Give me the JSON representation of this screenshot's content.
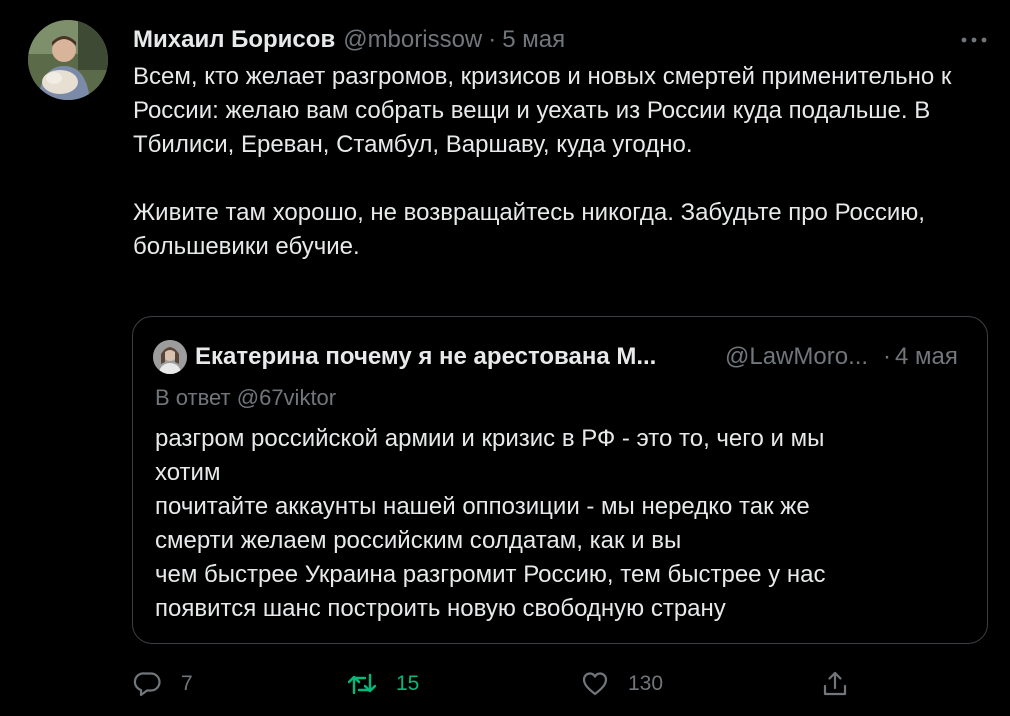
{
  "tweet": {
    "author_name": "Михаил Борисов",
    "handle": "@mborissow",
    "separator": "·",
    "date": "5 мая",
    "text_paragraphs": [
      "Всем, кто желает разгромов, кризисов и новых смертей применительно к России: желаю вам собрать вещи и уехать из России куда подальше. В Тбилиси, Ереван, Стамбул, Варшаву, куда угодно.",
      "Живите там хорошо, не возвращайтесь никогда. Забудьте про Россию, большевики ебучие."
    ]
  },
  "quote": {
    "author_name": "Екатерина почему я не арестована М...",
    "handle": "@LawMoro...",
    "separator": "·",
    "date": "4 мая",
    "reply_to": "В ответ @67viktor",
    "text_lines": [
      "разгром российской армии и кризис в РФ - это то, чего и мы",
      "хотим",
      "почитайте аккаунты нашей оппозиции - мы нередко так же",
      "смерти желаем российским солдатам, как и вы",
      "чем быстрее Украина разгромит Россию, тем быстрее у нас",
      "появится шанс построить новую свободную страну"
    ]
  },
  "actions": {
    "reply_count": "7",
    "retweet_count": "15",
    "like_count": "130",
    "icons": [
      "reply-icon",
      "retweet-icon",
      "like-icon",
      "share-icon"
    ]
  },
  "colors": {
    "background": "#000000",
    "text_primary": "#e7e9ea",
    "text_secondary": "#71767b",
    "retweet_active": "#00ba7c",
    "border": "#3b3f44"
  }
}
